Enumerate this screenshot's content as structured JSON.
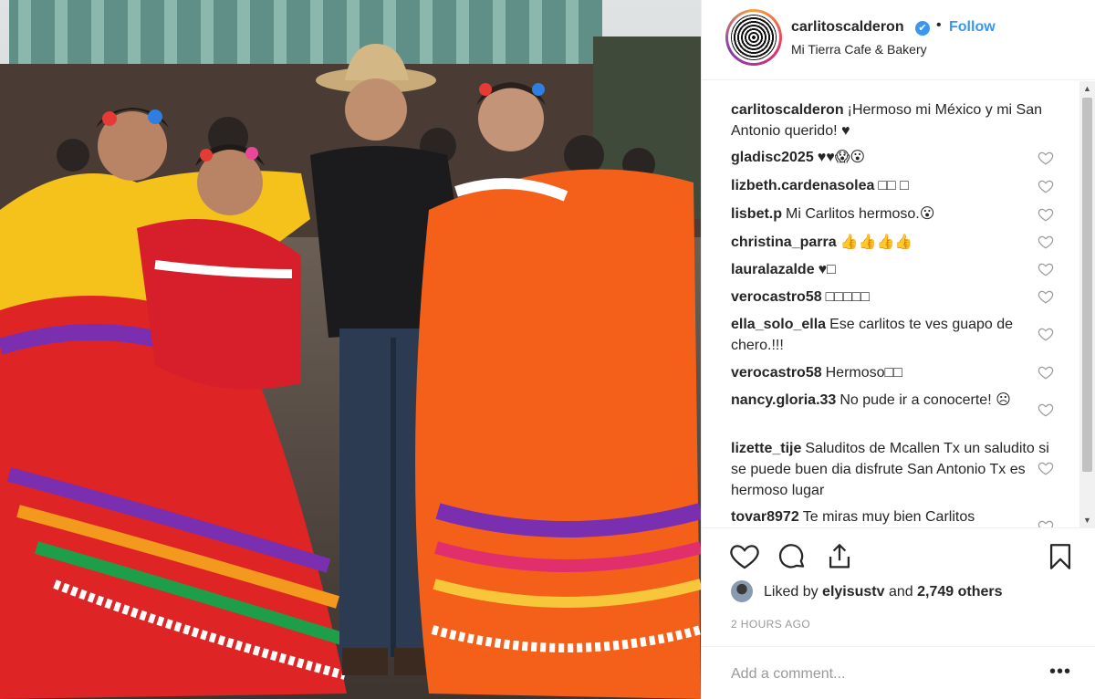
{
  "post": {
    "username": "carlitoscalderon",
    "verified_mark": "✔",
    "separator": "•",
    "follow_label": "Follow",
    "location": "Mi Tierra Cafe & Bakery"
  },
  "comments": [
    {
      "user": "carlitoscalderon",
      "text": "¡Hermoso mi México y mi San Antonio querido! ♥"
    },
    {
      "user": "gladisc2025",
      "text": "♥♥😱😮"
    },
    {
      "user": "lizbeth.cardenasolea",
      "text": "□□ □"
    },
    {
      "user": "lisbet.p",
      "text": "Mi Carlitos hermoso.😮"
    },
    {
      "user": "christina_parra",
      "text": "👍👍👍👍"
    },
    {
      "user": "lauralazalde",
      "text": "♥□"
    },
    {
      "user": "verocastro58",
      "text": "□□□□□"
    },
    {
      "user": "ella_solo_ella",
      "text": "Ese carlitos te ves guapo de chero.!!!"
    },
    {
      "user": "verocastro58",
      "text": "Hermoso□□"
    },
    {
      "user": "nancy.gloria.33",
      "text": "No pude ir a conocerte! ☹"
    },
    {
      "user": "lizette_tije",
      "text": "Saluditos de Mcallen Tx un saludito si se puede buen dia disfrute San Antonio Tx es hermoso lugar"
    },
    {
      "user": "tovar8972",
      "text": "Te miras muy bien Carlitos"
    }
  ],
  "scrollbar": {
    "up": "▲",
    "down": "▼"
  },
  "icons": {
    "like": "heart-icon",
    "comment": "comment-bubble-icon",
    "share": "share-icon",
    "save": "bookmark-icon",
    "comment_like": "small-heart-icon",
    "more": "ellipsis-icon"
  },
  "likes": {
    "prefix": "Liked by ",
    "user": "elyisustv",
    "middle": " and ",
    "count": "2,749 others"
  },
  "timestamp": "2 HOURS AGO",
  "add_comment": {
    "placeholder": "Add a comment...",
    "more_label": "•••"
  },
  "colors": {
    "accent": "#3897f0",
    "text": "#262626",
    "muted": "#999999",
    "border": "#efefef"
  }
}
